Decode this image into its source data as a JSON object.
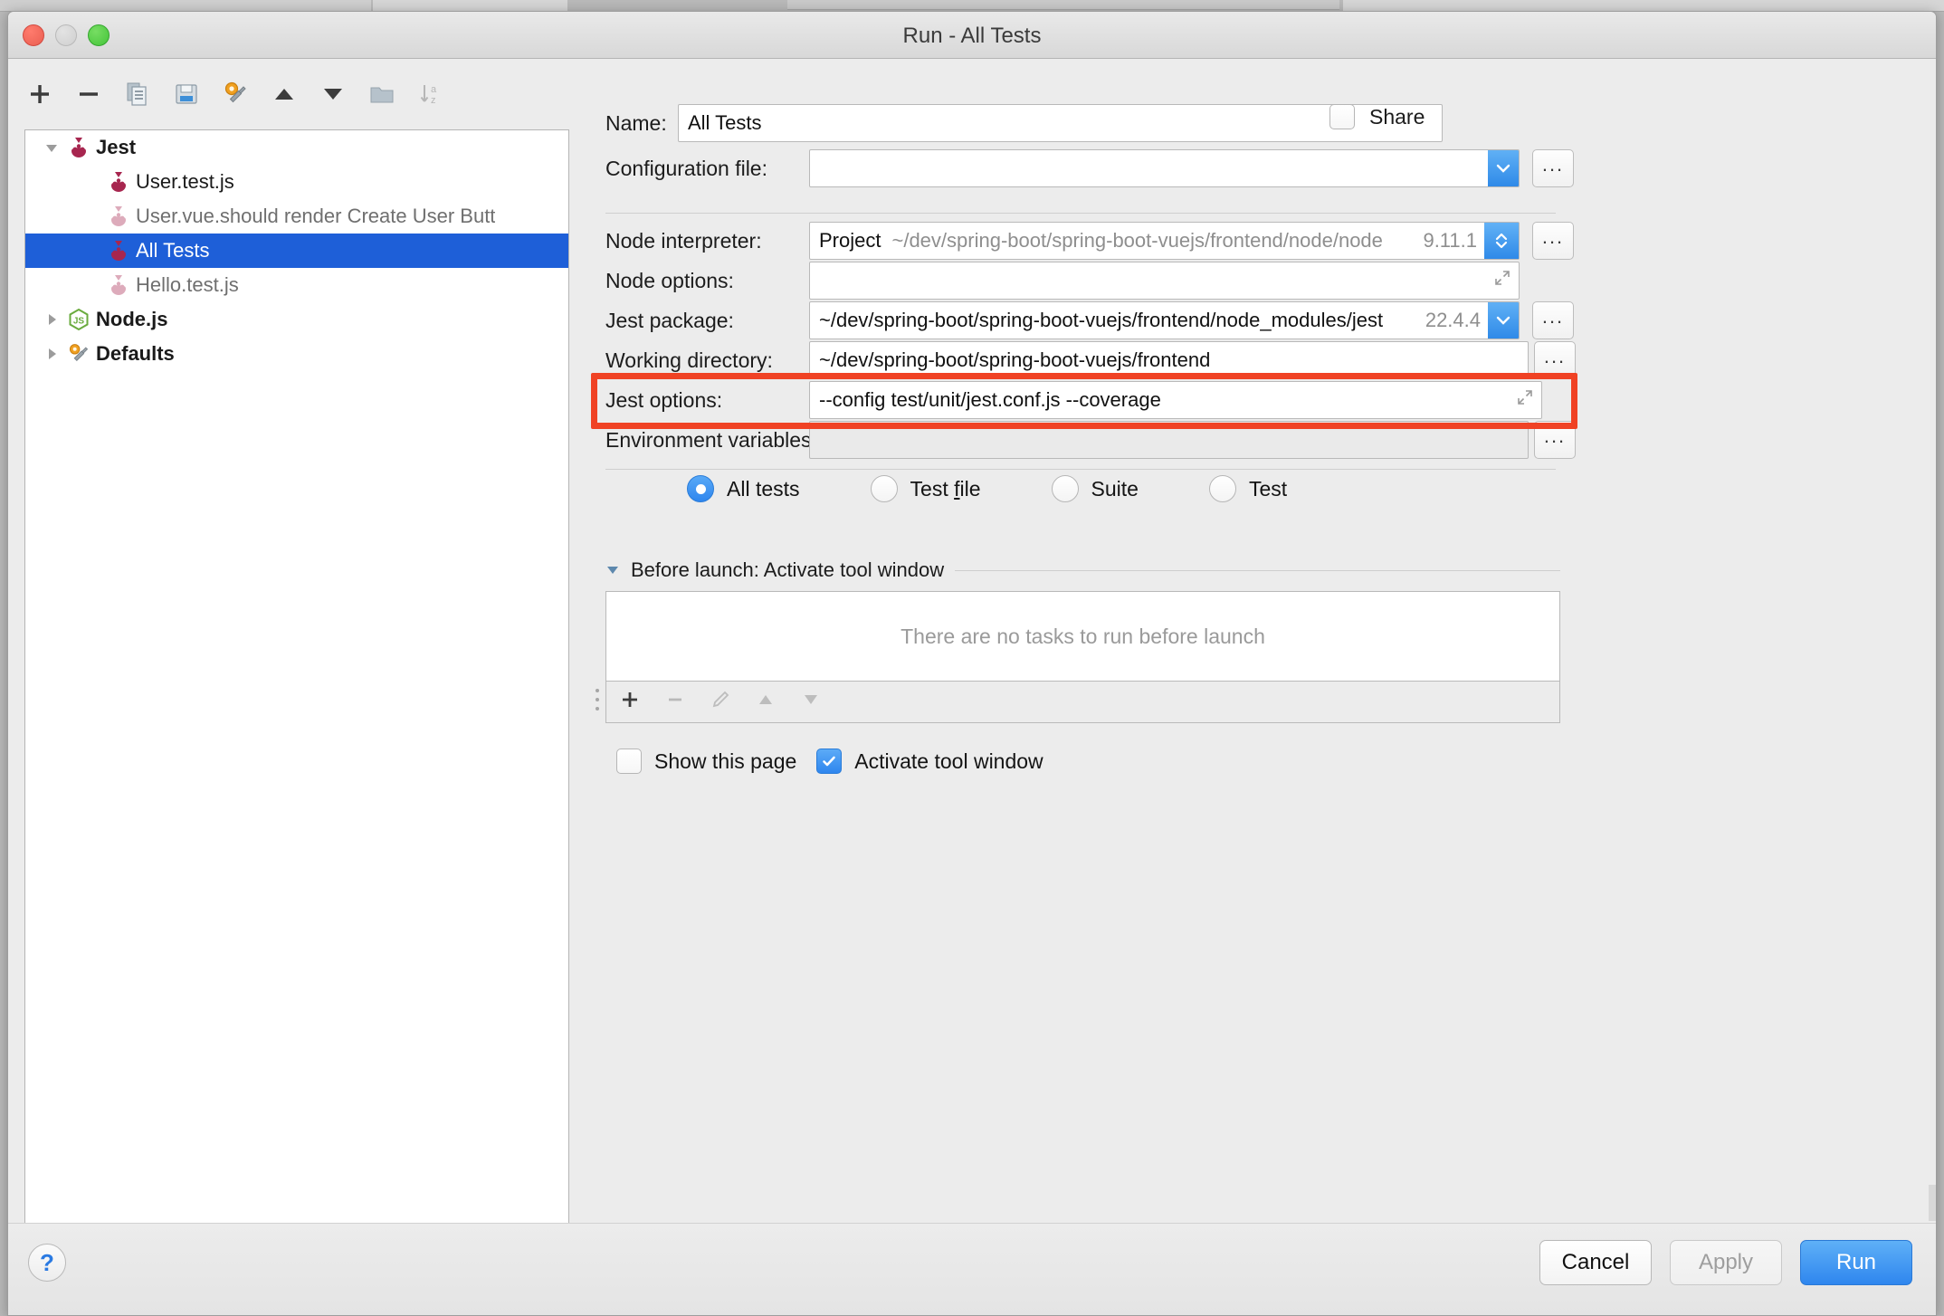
{
  "window": {
    "title": "Run - All Tests",
    "traffic_lights": [
      "close",
      "minimize",
      "zoom"
    ]
  },
  "toolbar": {
    "buttons": [
      {
        "name": "add",
        "icon": "plus-icon",
        "enabled": true
      },
      {
        "name": "remove",
        "icon": "minus-icon",
        "enabled": true
      },
      {
        "name": "copy",
        "icon": "copy-icon",
        "enabled": true
      },
      {
        "name": "save",
        "icon": "save-icon",
        "enabled": true
      },
      {
        "name": "edit-defaults",
        "icon": "wrench-icon",
        "enabled": true
      },
      {
        "name": "move-up",
        "icon": "triangle-up-icon",
        "enabled": true
      },
      {
        "name": "move-down",
        "icon": "triangle-down-icon",
        "enabled": true
      },
      {
        "name": "new-folder",
        "icon": "folder-icon",
        "enabled": true
      },
      {
        "name": "sort-alphabetically",
        "icon": "sort-az-icon",
        "enabled": false
      }
    ]
  },
  "tree": {
    "items": [
      {
        "label": "Jest",
        "level": 0,
        "twisty": "down",
        "icon": "jest-icon",
        "bold": true,
        "dim": false,
        "selected": false
      },
      {
        "label": "User.test.js",
        "level": 1,
        "twisty": "none",
        "icon": "jest-icon",
        "bold": false,
        "dim": false,
        "selected": false
      },
      {
        "label": "User.vue.should render Create User Butt",
        "level": 1,
        "twisty": "none",
        "icon": "jest-icon-faded",
        "bold": false,
        "dim": true,
        "selected": false
      },
      {
        "label": "All Tests",
        "level": 1,
        "twisty": "none",
        "icon": "jest-icon",
        "bold": false,
        "dim": false,
        "selected": true
      },
      {
        "label": "Hello.test.js",
        "level": 1,
        "twisty": "none",
        "icon": "jest-icon-faded",
        "bold": false,
        "dim": true,
        "selected": false
      },
      {
        "label": "Node.js",
        "level": 0,
        "twisty": "right",
        "icon": "nodejs-icon",
        "bold": true,
        "dim": false,
        "selected": false
      },
      {
        "label": "Defaults",
        "level": 0,
        "twisty": "right",
        "icon": "wrench-icon",
        "bold": true,
        "dim": false,
        "selected": false
      }
    ]
  },
  "form": {
    "name_label": "Name:",
    "name_value": "All Tests",
    "share_label": "Share",
    "share_checked": false,
    "configuration_file_label": "Configuration file:",
    "configuration_file_value": "",
    "node_interpreter_label": "Node interpreter:",
    "node_interpreter_prefix": "Project",
    "node_interpreter_path": "~/dev/spring-boot/spring-boot-vuejs/frontend/node/node",
    "node_interpreter_version": "9.11.1",
    "node_options_label": "Node options:",
    "node_options_value": "",
    "jest_package_label": "Jest package:",
    "jest_package_value": "~/dev/spring-boot/spring-boot-vuejs/frontend/node_modules/jest",
    "jest_package_version": "22.4.4",
    "working_directory_label": "Working directory:",
    "working_directory_value": "~/dev/spring-boot/spring-boot-vuejs/frontend",
    "jest_options_label": "Jest options:",
    "jest_options_value": "--config test/unit/jest.conf.js --coverage",
    "jest_options_highlighted": true,
    "highlight_color": "#f04224",
    "environment_variables_label": "Environment variables:",
    "environment_variables_value": "",
    "scope_options": [
      {
        "label": "All tests",
        "selected": true,
        "mnemonic": ""
      },
      {
        "label": "Test file",
        "selected": false,
        "mnemonic": "f"
      },
      {
        "label": "Suite",
        "selected": false,
        "mnemonic": ""
      },
      {
        "label": "Test",
        "selected": false,
        "mnemonic": ""
      }
    ],
    "before_launch_title": "Before launch: Activate tool window",
    "before_launch_empty_text": "There are no tasks to run before launch",
    "before_launch_toolbar": [
      {
        "name": "add-task",
        "icon": "plus-icon",
        "enabled": true
      },
      {
        "name": "remove-task",
        "icon": "minus-icon",
        "enabled": false
      },
      {
        "name": "edit-task",
        "icon": "pencil-icon",
        "enabled": false
      },
      {
        "name": "move-task-up",
        "icon": "triangle-up-icon",
        "enabled": false
      },
      {
        "name": "move-task-down",
        "icon": "triangle-down-icon",
        "enabled": false
      }
    ],
    "show_this_page_label": "Show this page",
    "show_this_page_checked": false,
    "activate_tool_window_label": "Activate tool window",
    "activate_tool_window_checked": true
  },
  "footer": {
    "help_glyph": "?",
    "cancel_label": "Cancel",
    "apply_label": "Apply",
    "apply_enabled": false,
    "run_label": "Run"
  },
  "colors": {
    "accent_blue": "#2f86ee",
    "selection_blue": "#1e5fd8",
    "highlight_red": "#f04224",
    "jest_magenta": "#a7264f",
    "node_green": "#6aab3e"
  }
}
